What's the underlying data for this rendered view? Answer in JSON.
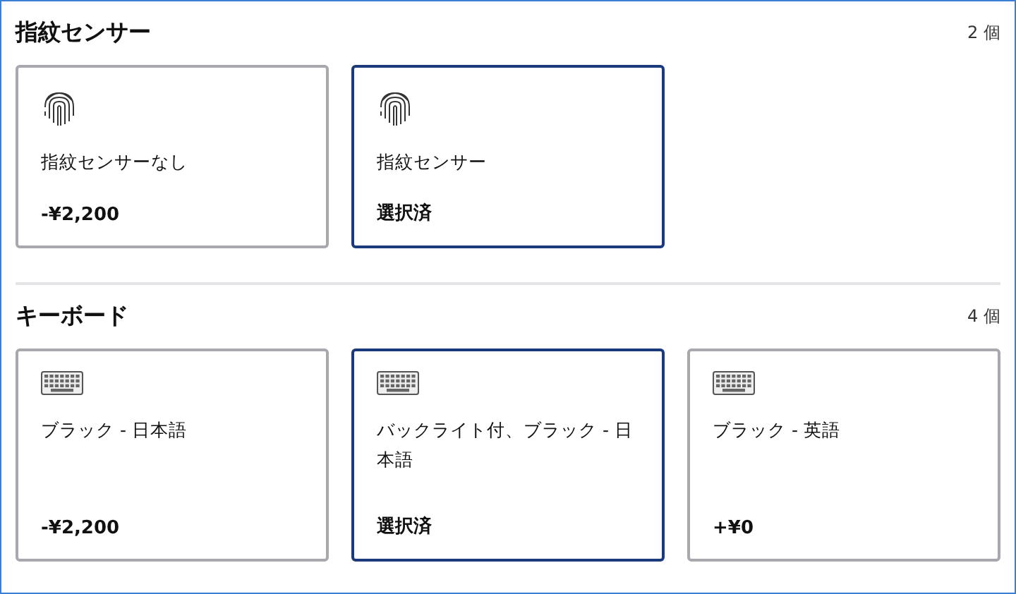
{
  "sections": [
    {
      "kind": "fingerprint",
      "title": "指紋センサー",
      "count": "2 個",
      "options": [
        {
          "label": "指紋センサーなし",
          "price": "-¥2,200",
          "selected": false
        },
        {
          "label": "指紋センサー",
          "price": "選択済",
          "selected": true
        }
      ]
    },
    {
      "kind": "keyboard",
      "title": "キーボード",
      "count": "4 個",
      "options": [
        {
          "label": "ブラック - 日本語",
          "price": "-¥2,200",
          "selected": false
        },
        {
          "label": "バックライト付、ブラック - 日本語",
          "price": "選択済",
          "selected": true
        },
        {
          "label": "ブラック - 英語",
          "price": "+¥0",
          "selected": false
        }
      ]
    }
  ]
}
